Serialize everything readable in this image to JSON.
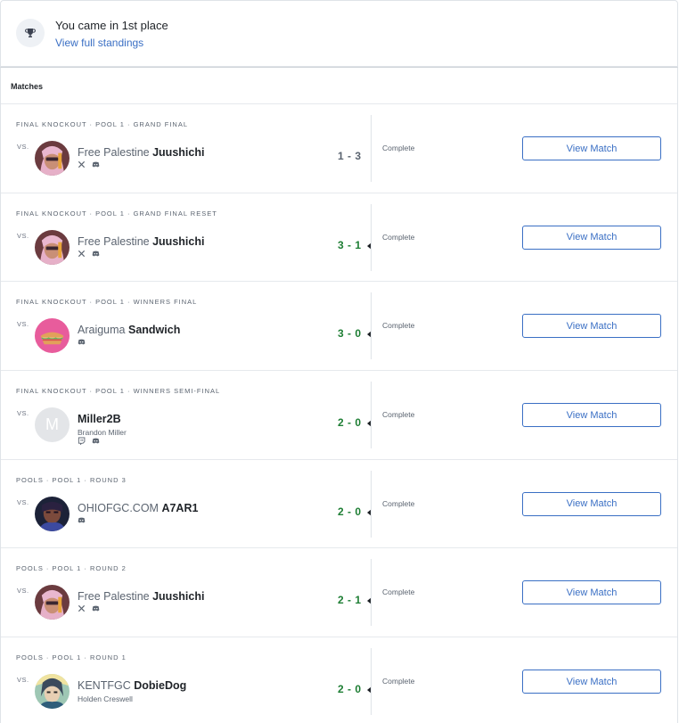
{
  "standings": {
    "place_text": "You came in 1st place",
    "link_text": "View full standings",
    "icon": "trophy-icon"
  },
  "matches": {
    "header": "Matches",
    "view_button_label": "View Match",
    "vs_label": "VS.",
    "rows": [
      {
        "round": "FINAL KNOCKOUT · POOL 1 · GRAND FINAL",
        "prefix": "Free Palestine",
        "tag": "Juushichi",
        "subname": "",
        "socials": [
          "x-icon",
          "discord-icon"
        ],
        "avatar": "anime-avatar-pink",
        "score": "1 - 3",
        "result": "loss",
        "status": "Complete"
      },
      {
        "round": "FINAL KNOCKOUT · POOL 1 · GRAND FINAL RESET",
        "prefix": "Free Palestine",
        "tag": "Juushichi",
        "subname": "",
        "socials": [
          "x-icon",
          "discord-icon"
        ],
        "avatar": "anime-avatar-pink",
        "score": "3 - 1",
        "result": "win",
        "status": "Complete"
      },
      {
        "round": "FINAL KNOCKOUT · POOL 1 · WINNERS FINAL",
        "prefix": "Araiguma",
        "tag": "Sandwich",
        "subname": "",
        "socials": [
          "discord-icon"
        ],
        "avatar": "sandwich-avatar",
        "score": "3 - 0",
        "result": "win",
        "status": "Complete"
      },
      {
        "round": "FINAL KNOCKOUT · POOL 1 · WINNERS SEMI-FINAL",
        "prefix": "",
        "tag": "Miller2B",
        "subname": "Brandon Miller",
        "socials": [
          "twitch-icon",
          "discord-icon"
        ],
        "avatar": "letter-avatar",
        "avatar_letter": "M",
        "score": "2 - 0",
        "result": "win",
        "status": "Complete"
      },
      {
        "round": "POOLS · POOL 1 · ROUND 3",
        "prefix": "OHIOFGC.COM",
        "tag": "A7AR1",
        "subname": "",
        "socials": [
          "discord-icon"
        ],
        "avatar": "dark-portrait-avatar",
        "score": "2 - 0",
        "result": "win",
        "status": "Complete"
      },
      {
        "round": "POOLS · POOL 1 · ROUND 2",
        "prefix": "Free Palestine",
        "tag": "Juushichi",
        "subname": "",
        "socials": [
          "x-icon",
          "discord-icon"
        ],
        "avatar": "anime-avatar-pink",
        "score": "2 - 1",
        "result": "win",
        "status": "Complete"
      },
      {
        "round": "POOLS · POOL 1 · ROUND 1",
        "prefix": "KENTFGC",
        "tag": "DobieDog",
        "subname": "Holden Creswell",
        "socials": [],
        "avatar": "anime-avatar-green",
        "score": "2 - 0",
        "result": "win",
        "status": "Complete"
      }
    ]
  },
  "colors": {
    "accent": "#3a6fc4",
    "win": "#1e7e34",
    "muted": "#5b6470",
    "border": "#dfe3e8"
  }
}
